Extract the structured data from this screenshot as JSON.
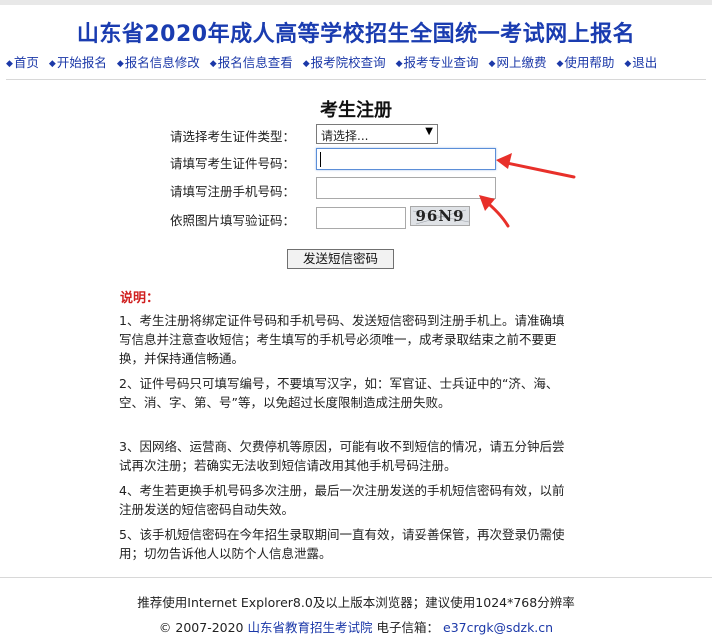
{
  "header": {
    "title": "山东省2020年成人高等学校招生全国统一考试网上报名"
  },
  "nav": {
    "items": [
      {
        "label": "首页"
      },
      {
        "label": "开始报名"
      },
      {
        "label": "报名信息修改"
      },
      {
        "label": "报名信息查看"
      },
      {
        "label": "报考院校查询"
      },
      {
        "label": "报考专业查询"
      },
      {
        "label": "网上缴费"
      },
      {
        "label": "使用帮助"
      },
      {
        "label": "退出"
      }
    ],
    "bullet": "◆"
  },
  "form": {
    "title": "考生注册",
    "id_type_label": "请选择考生证件类型：",
    "id_type_selected": "请选择...",
    "id_number_label": "请填写考生证件号码：",
    "id_number_value": "",
    "phone_label": "请填写注册手机号码：",
    "phone_value": "",
    "captcha_label": "依照图片填写验证码：",
    "captcha_value": "",
    "captcha_image_text": "96N9",
    "send_button": "发送短信密码"
  },
  "notes": {
    "heading": "说明：",
    "items": [
      "1、考生注册将绑定证件号码和手机号码、发送短信密码到注册手机上。请准确填写信息并注意查收短信；考生填写的手机号必须唯一，成考录取结束之前不要更换，并保持通信畅通。",
      "2、证件号码只可填写编号，不要填写汉字，如：军官证、士兵证中的“济、海、空、消、字、第、号”等，以免超过长度限制造成注册失败。",
      "3、因网络、运营商、欠费停机等原因，可能有收不到短信的情况，请五分钟后尝试再次注册；若确实无法收到短信请改用其他手机号码注册。",
      "4、考生若更换手机号码多次注册，最后一次注册发送的手机短信密码有效，以前注册发送的短信密码自动失效。",
      "5、该手机短信密码在今年招生录取期间一直有效，请妥善保管，再次登录仍需使用；切勿告诉他人以防个人信息泄露。"
    ]
  },
  "footer": {
    "browser_tip": "推荐使用Internet Explorer8.0及以上版本浏览器；建议使用1024*768分辨率",
    "copyright": "© 2007-2020",
    "org_link": "山东省教育招生考试院",
    "email_label": "电子信箱：",
    "email": "e37crgk@sdzk.cn"
  },
  "colors": {
    "title_blue": "#1a3cb0",
    "nav_blue": "#1b38a8",
    "note_red": "#d01f1f",
    "annotation_arrow": "#e8302a"
  },
  "icons": {
    "select_arrow": "triangle-down-icon",
    "annotation": "red-arrow-icon"
  }
}
